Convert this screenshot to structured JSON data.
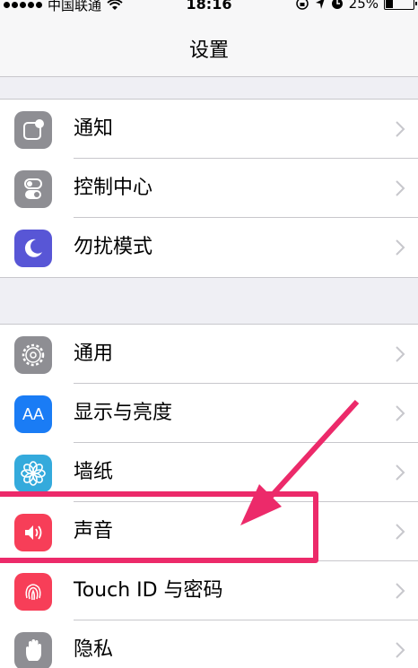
{
  "status_bar": {
    "carrier": "中国联通",
    "time": "18:16",
    "battery": "25%",
    "battery_level": 0.25
  },
  "nav": {
    "title": "设置"
  },
  "group1": {
    "items": [
      {
        "label": "通知",
        "icon": "notifications-icon",
        "color": "#8e8e93"
      },
      {
        "label": "控制中心",
        "icon": "control-center-icon",
        "color": "#8e8e93"
      },
      {
        "label": "勿扰模式",
        "icon": "moon-icon",
        "color": "#5856d6"
      }
    ]
  },
  "group2": {
    "items": [
      {
        "label": "通用",
        "icon": "gear-icon",
        "color": "#8e8e93"
      },
      {
        "label": "显示与亮度",
        "icon": "display-brightness-icon",
        "icon_text": "AA",
        "color": "#1a7cf5"
      },
      {
        "label": "墙纸",
        "icon": "wallpaper-flower-icon",
        "color": "#34aadc"
      },
      {
        "label": "声音",
        "icon": "speaker-icon",
        "color": "#f73e58"
      },
      {
        "label": "Touch ID 与密码",
        "icon": "fingerprint-icon",
        "color": "#f73e58"
      },
      {
        "label": "隐私",
        "icon": "hand-icon",
        "color": "#8e8e93"
      }
    ]
  },
  "annotation": {
    "highlight_color": "#ec2a6a"
  }
}
